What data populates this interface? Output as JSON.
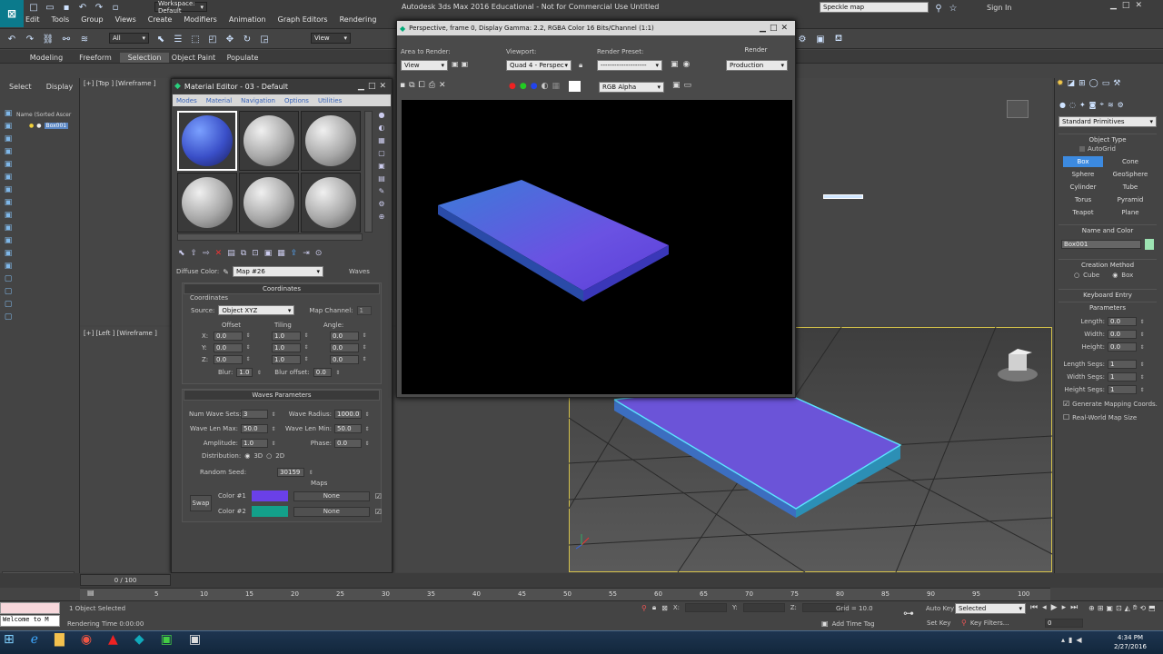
{
  "app": {
    "menu": [
      "Edit",
      "Tools",
      "Group",
      "Views",
      "Create",
      "Modifiers",
      "Animation",
      "Graph Editors",
      "Rendering"
    ],
    "workspace": "Workspace: Default",
    "title": "Autodesk 3ds Max 2016 Educational - Not for Commercial Use   Untitled",
    "search": "Speckle map",
    "sign_in": "Sign In",
    "filter": "All",
    "view": "View"
  },
  "ribbon_tabs": [
    "Modeling",
    "Freeform",
    "Selection",
    "Object Paint",
    "Populate"
  ],
  "scene_explorer": {
    "tabs": [
      "Select",
      "Display"
    ],
    "column": "Name (Sorted Ascer",
    "item": "Box001"
  },
  "viewports": {
    "top": "[+] [Top ] [Wireframe ]",
    "left": "[+] [Left ] [Wireframe ]"
  },
  "mat_editor": {
    "title": "Material Editor - 03 - Default",
    "menus": [
      "Modes",
      "Material",
      "Navigation",
      "Options",
      "Utilities"
    ],
    "diffuse_label": "Diffuse Color:",
    "map_name": "Map #26",
    "map_type": "Waves",
    "coords": {
      "title": "Coordinates",
      "sub": "Coordinates",
      "source_label": "Source:",
      "source": "Object XYZ",
      "channel_label": "Map Channel:",
      "channel": "1",
      "offset": "Offset",
      "tiling": "Tiling",
      "angle": "Angle:",
      "x": "X:",
      "y": "Y:",
      "z": "Z:",
      "off": "0.0",
      "til": "1.0",
      "ang": "0.0",
      "blur_label": "Blur:",
      "blur": "1.0",
      "bluroff_label": "Blur offset:",
      "bluroff": "0.0"
    },
    "waves": {
      "title": "Waves Parameters",
      "num_sets_label": "Num Wave Sets:",
      "num_sets": "3",
      "radius_label": "Wave Radius:",
      "radius": "1000.0",
      "lenmax_label": "Wave Len Max:",
      "lenmax": "50.0",
      "lenmin_label": "Wave Len Min:",
      "lenmin": "50.0",
      "amp_label": "Amplitude:",
      "amp": "1.0",
      "phase_label": "Phase:",
      "phase": "0.0",
      "dist_label": "Distribution:",
      "d3": "3D",
      "d2": "2D",
      "seed_label": "Random Seed:",
      "seed": "30159",
      "maps": "Maps",
      "swap": "Swap",
      "c1": "Color #1",
      "c2": "Color #2",
      "none": "None",
      "color1": "#6a40e8",
      "color2": "#13a08a"
    }
  },
  "render_frame": {
    "title": "Perspective, frame 0, Display Gamma: 2.2, RGBA Color 16 Bits/Channel (1:1)",
    "area_label": "Area to Render:",
    "area": "View",
    "viewport_label": "Viewport:",
    "viewport": "Quad 4 - Perspec",
    "preset_label": "Render Preset:",
    "preset": "--------------------",
    "render_btn": "Render",
    "production": "Production",
    "channel": "RGB Alpha"
  },
  "command_panel": {
    "category": "Standard Primitives",
    "object_type": "Object Type",
    "autogrid": "AutoGrid",
    "prims": [
      "Box",
      "Cone",
      "Sphere",
      "GeoSphere",
      "Cylinder",
      "Tube",
      "Torus",
      "Pyramid",
      "Teapot",
      "Plane"
    ],
    "name_color": "Name and Color",
    "name": "Box001",
    "creation": "Creation Method",
    "cube": "Cube",
    "box": "Box",
    "keyboard": "Keyboard Entry",
    "params": "Parameters",
    "length_label": "Length:",
    "width_label": "Width:",
    "height_label": "Height:",
    "length": "0.0",
    "width": "0.0",
    "height": "0.0",
    "lsegs_label": "Length Segs:",
    "wsegs_label": "Width Segs:",
    "hsegs_label": "Height Segs:",
    "segs": "1",
    "gen_map": "Generate Mapping Coords.",
    "real_world": "Real-World Map Size"
  },
  "timeline": {
    "frame": "0 / 100",
    "ticks": [
      "5",
      "10",
      "15",
      "20",
      "25",
      "30",
      "35",
      "40",
      "45",
      "50",
      "55",
      "60",
      "65",
      "70",
      "75",
      "80",
      "85",
      "90",
      "95",
      "100"
    ]
  },
  "status": {
    "selected": "1 Object Selected",
    "render_time": "Rendering Time 0:00:00",
    "welcome": "Welcome to M",
    "x": "X:",
    "y": "Y:",
    "z": "Z:",
    "grid": "Grid = 10.0",
    "add_tag": "Add Time Tag",
    "auto_key": "Auto Key",
    "set_key": "Set Key",
    "selected_dd": "Selected",
    "key_filters": "Key Filters...",
    "frame": "0"
  },
  "taskbar": {
    "time": "4:34 PM",
    "date": "2/27/2016"
  }
}
